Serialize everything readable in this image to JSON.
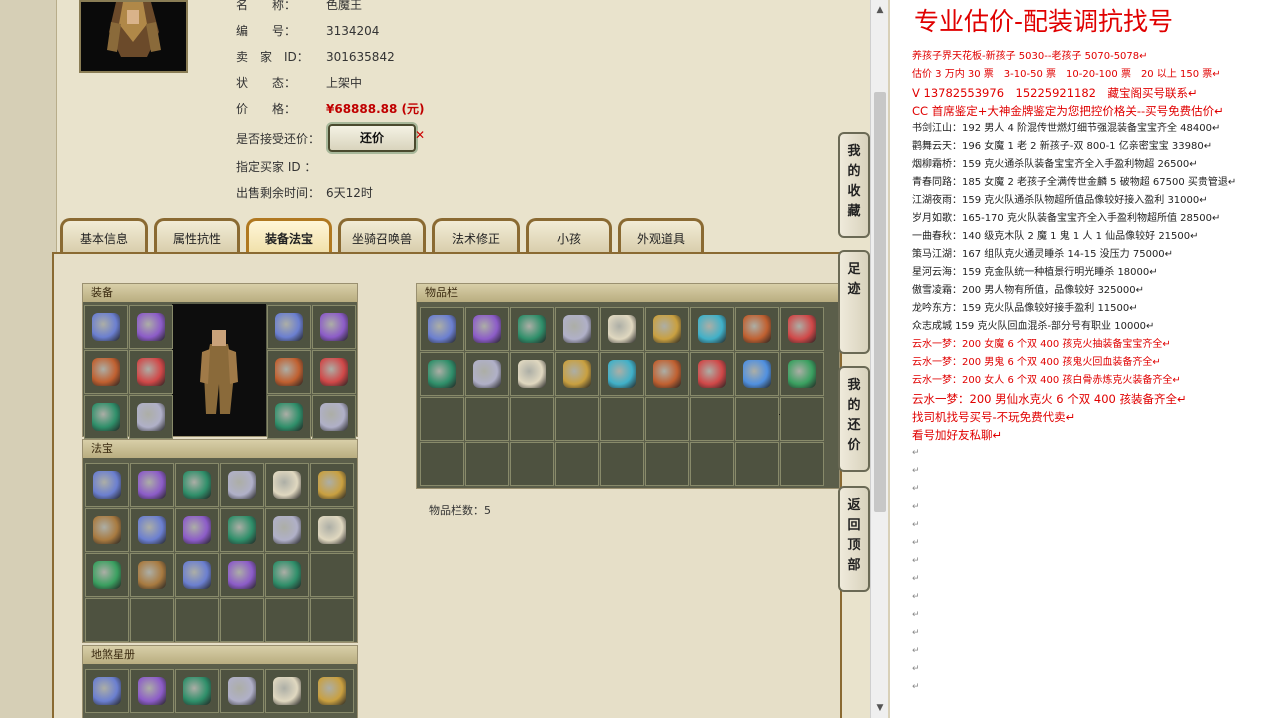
{
  "listing": {
    "name_key": "名　　称：",
    "name_value": "色魔王",
    "id_key": "编　　号：",
    "id_value": "3134204",
    "seller_key": "卖　家　ID：",
    "seller_value": "301635842",
    "status_key": "状　　态：",
    "status_value": "上架中",
    "price_key": "价　　格：",
    "price_value": "¥68888.88 (元)",
    "bargain_key": "是否接受还价：",
    "bargain_button": "还价",
    "buyer_key": "指定买家 ID ：",
    "remaining_key": "出售剩余时间：",
    "remaining_value": "6天12时"
  },
  "tabs": [
    "基本信息",
    "属性抗性",
    "装备法宝",
    "坐骑召唤兽",
    "法术修正",
    "小孩",
    "外观道具"
  ],
  "active_tab": "装备法宝",
  "panels": {
    "equipment": "装备",
    "treasure": "法宝",
    "inventory": "物品栏",
    "inventory_count": "物品栏数：5",
    "star_book": "地煞星册"
  },
  "side_buttons": [
    "我的收藏",
    "足迹",
    "我的还价",
    "返回顶部"
  ],
  "right_panel": {
    "title": "专业估价-配装调抗找号",
    "lines": [
      {
        "text": "养孩子界天花板-新孩子 5030--老孩子 5070-5078",
        "color": "red"
      },
      {
        "text": "估价 3 万内 30 票　3-10-50 票　10-20-100 票　20 以上 150 票",
        "color": "red"
      },
      {
        "text": "V 13782553976　15225921182　藏宝阁买号联系",
        "color": "red",
        "big": true
      },
      {
        "text": "CC 首席鉴定+大神金牌鉴定为您把控价格关--买号免费估价",
        "color": "red",
        "big": true
      },
      {
        "text": "书剑江山：192 男人 4 阶混传世燃灯细节强混装备宝宝齐全 48400",
        "color": "dark"
      },
      {
        "text": "鹳舞云天：196 女魔 1 老 2 新孩子-双 800-1 亿亲密宝宝 33980",
        "color": "dark"
      },
      {
        "text": "烟柳霜桥：159 克火通杀队装备宝宝齐全入手盈利物超 26500",
        "color": "dark"
      },
      {
        "text": "青春同路：185 女魔 2 老孩子全满传世金麟 5 破物超 67500 买贵管退",
        "color": "dark"
      },
      {
        "text": "江湖夜雨：159 克火队通杀队物超所值品像较好接入盈利 31000",
        "color": "dark"
      },
      {
        "text": "岁月如歌：165-170 克火队装备宝宝齐全入手盈利物超所值 28500",
        "color": "dark"
      },
      {
        "text": "一曲春秋：140 级克木队 2 魔 1 鬼 1 人 1 仙品像较好 21500",
        "color": "dark"
      },
      {
        "text": "策马江湖：167 组队克火通灵睡杀 14-15 没压力 75000",
        "color": "dark"
      },
      {
        "text": "星河云海：159 克金队统一种植景行明光睡杀 18000",
        "color": "dark"
      },
      {
        "text": "傲雪凌霜：200 男人物有所值，品像较好 325000",
        "color": "dark"
      },
      {
        "text": "龙吟东方：159 克火队品像较好接手盈利 11500",
        "color": "dark"
      },
      {
        "text": "众志成城 159 克火队回血混杀-部分号有职业 10000",
        "color": "dark"
      },
      {
        "text": "云水一梦：200 女魔 6 个双 400 孩克火抽装备宝宝齐全",
        "color": "red"
      },
      {
        "text": "云水一梦：200 男鬼 6 个双 400 孩鬼火回血装备齐全",
        "color": "red"
      },
      {
        "text": "云水一梦：200 女人 6 个双 400 孩白骨赤炼克火装备齐全",
        "color": "red"
      },
      {
        "text": "云水一梦：200 男仙水克火 6 个双 400 孩装备齐全",
        "color": "red",
        "big": true
      },
      {
        "text": "找司机找号买号-不玩免费代卖",
        "color": "red",
        "big": true
      },
      {
        "text": "看号加好友私聊",
        "color": "red",
        "big": true
      }
    ],
    "para_mark": "↵"
  }
}
